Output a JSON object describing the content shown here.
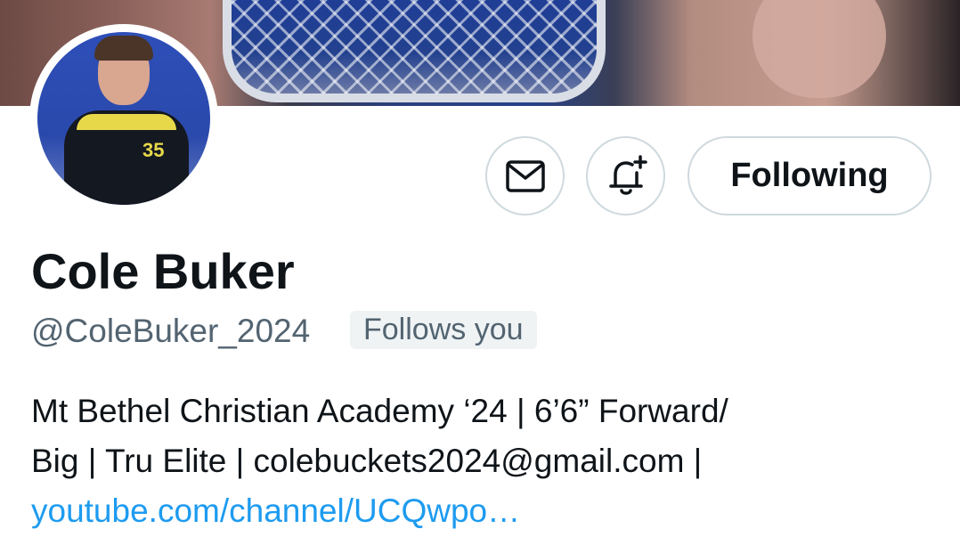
{
  "banner": {
    "description_icon": "ring-photo"
  },
  "avatar": {
    "jersey_number": "35"
  },
  "actions": {
    "message_icon": "mail-icon",
    "notify_icon": "bell-plus-icon",
    "follow_label": "Following"
  },
  "profile": {
    "name": "Cole Buker",
    "handle": "@ColeBuker_2024",
    "follows_you": "Follows you",
    "bio_line1": "Mt Bethel Christian Academy ‘24 | 6’6” Forward/",
    "bio_line2": "Big | Tru Elite | colebuckets2024@gmail.com |",
    "bio_link": "youtube.com/channel/UCQwpo…"
  },
  "colors": {
    "text": "#0f1419",
    "muted": "#536471",
    "link": "#1d9bf0",
    "border": "#cfd9de"
  }
}
